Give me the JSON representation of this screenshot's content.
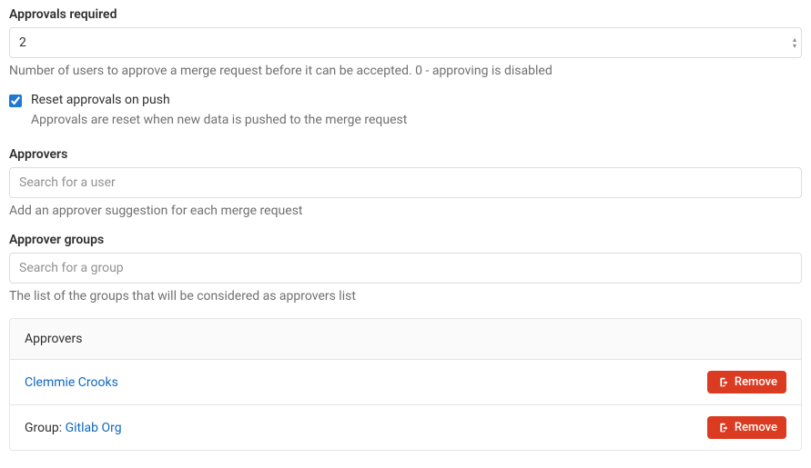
{
  "approvals_required": {
    "label": "Approvals required",
    "value": "2",
    "help": "Number of users to approve a merge request before it can be accepted. 0 - approving is disabled"
  },
  "reset_approvals": {
    "label": "Reset approvals on push",
    "checked": true,
    "help": "Approvals are reset when new data is pushed to the merge request"
  },
  "approvers": {
    "label": "Approvers",
    "placeholder": "Search for a user",
    "help": "Add an approver suggestion for each merge request"
  },
  "approver_groups": {
    "label": "Approver groups",
    "placeholder": "Search for a group",
    "help": "The list of the groups that will be considered as approvers list"
  },
  "approvers_list": {
    "header": "Approvers",
    "items": [
      {
        "type": "user",
        "name": "Clemmie Crooks"
      },
      {
        "type": "group",
        "prefix": "Group: ",
        "name": "Gitlab Org"
      }
    ],
    "remove_label": "Remove"
  }
}
